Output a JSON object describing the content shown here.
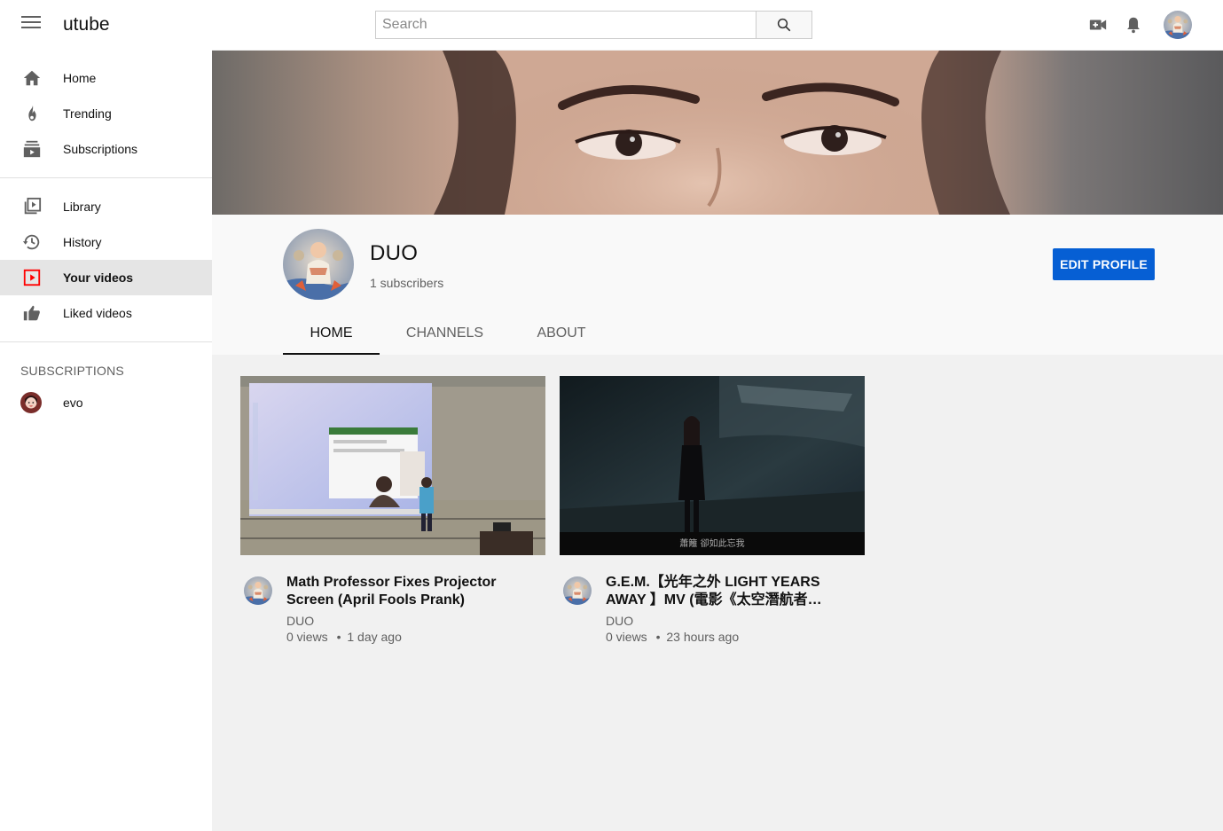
{
  "app": {
    "logo": "utube"
  },
  "search": {
    "placeholder": "Search"
  },
  "topbar": {
    "icons": [
      "create-video-icon",
      "notification-bell-icon"
    ]
  },
  "sidebar": {
    "main": [
      {
        "label": "Home",
        "icon": "home-icon"
      },
      {
        "label": "Trending",
        "icon": "flame-icon"
      },
      {
        "label": "Subscriptions",
        "icon": "subscriptions-icon"
      }
    ],
    "library": [
      {
        "label": "Library",
        "icon": "library-icon"
      },
      {
        "label": "History",
        "icon": "history-icon"
      },
      {
        "label": "Your videos",
        "icon": "your-videos-icon",
        "active": true
      },
      {
        "label": "Liked videos",
        "icon": "thumbs-up-icon"
      }
    ],
    "subscriptions_title": "SUBSCRIPTIONS",
    "subscriptions": [
      {
        "label": "evo"
      }
    ]
  },
  "channel": {
    "name": "DUO",
    "subscribers": "1 subscribers",
    "edit_label": "EDIT PROFILE",
    "tabs": [
      {
        "label": "HOME",
        "active": true
      },
      {
        "label": "CHANNELS"
      },
      {
        "label": "ABOUT"
      }
    ]
  },
  "videos": [
    {
      "title": "Math Professor Fixes Projector Screen (April Fools Prank)",
      "channel": "DUO",
      "views": "0 views",
      "age": "1 day ago"
    },
    {
      "title": "G.E.M.【光年之外 LIGHT YEARS AWAY 】MV (電影《太空潛航者 Passengers》中文主題曲)",
      "channel": "DUO",
      "views": "0 views",
      "age": "23 hours ago",
      "subtitle": "蕭籬 卻如此忘我"
    }
  ],
  "colors": {
    "accent": "#065fd4",
    "active_icon": "#ff0000"
  }
}
